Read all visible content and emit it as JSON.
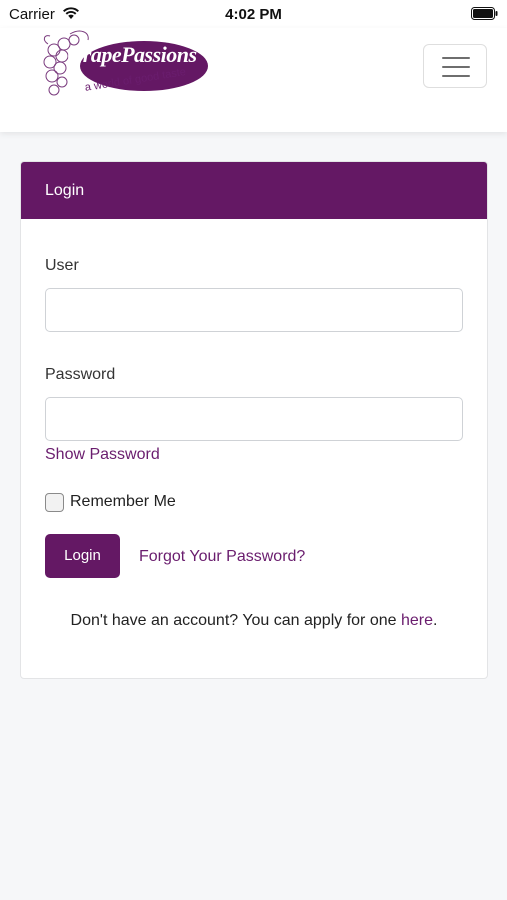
{
  "status_bar": {
    "carrier": "Carrier",
    "time": "4:02 PM"
  },
  "brand": {
    "logo_text": "GrapePassions",
    "tagline": "a world of good taste",
    "color": "#641864"
  },
  "navbar": {
    "menu_icon": "hamburger-menu-icon"
  },
  "login_card": {
    "header": "Login",
    "user_label": "User",
    "user_value": "",
    "password_label": "Password",
    "password_value": "",
    "show_password": "Show Password",
    "remember_me": "Remember Me",
    "remember_checked": false,
    "login_button": "Login",
    "forgot_password": "Forgot Your Password?",
    "apply_text": "Don't have an account? You can apply for one ",
    "apply_link": "here",
    "apply_suffix": "."
  }
}
